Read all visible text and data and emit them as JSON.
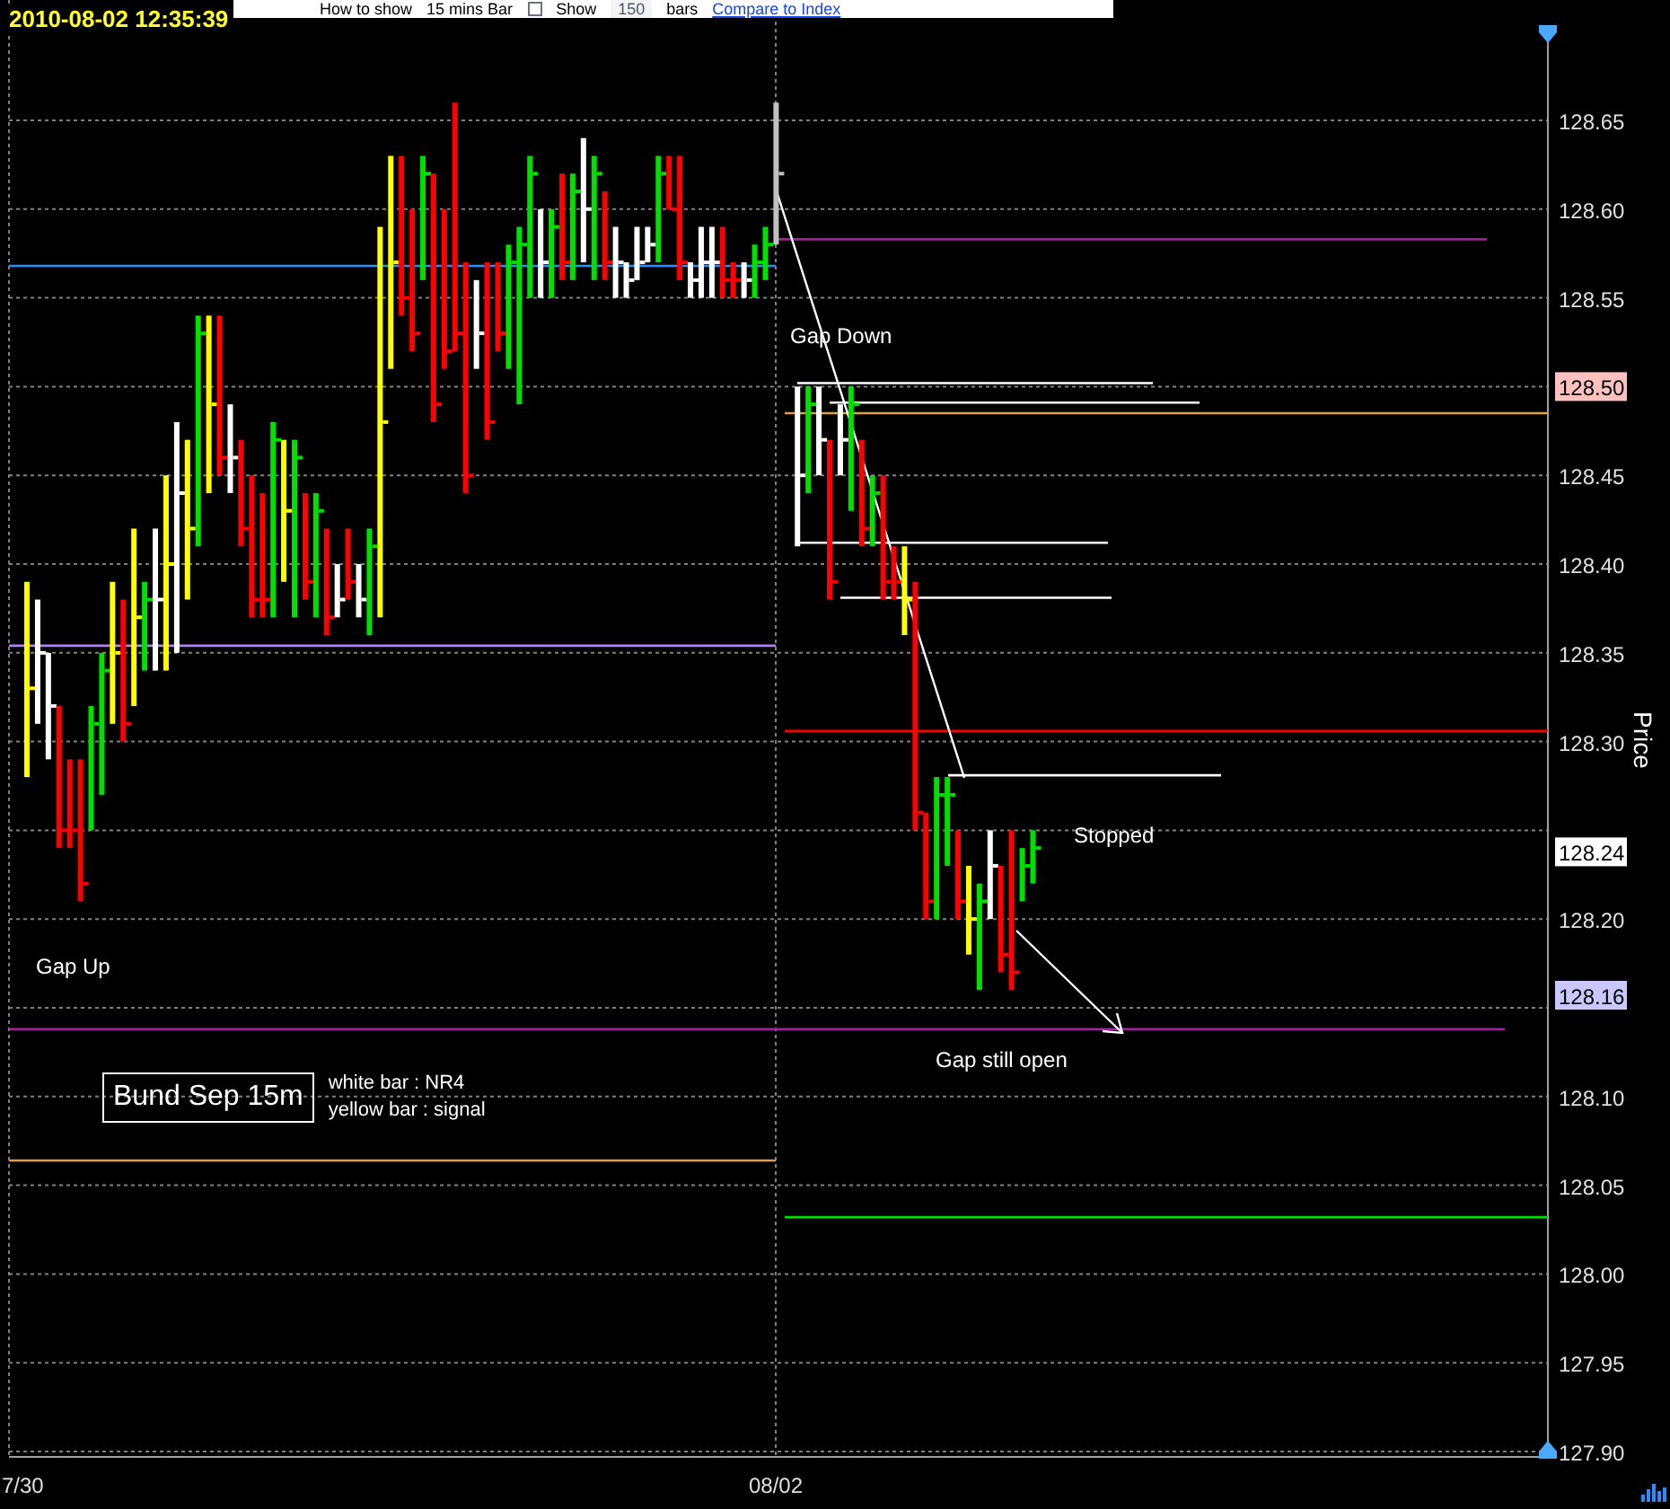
{
  "timestamp": "2010-08-02 12:35:39",
  "toolbar": {
    "how_to_show_label": "How to show",
    "interval": "15 mins Bar",
    "show": {
      "label": "Show",
      "checked": false
    },
    "bar_count": "150",
    "bars_label": "bars",
    "compare_link": "Compare to Index"
  },
  "legend": {
    "title": "Bund Sep 15m",
    "lines": [
      "white bar : NR4",
      "yellow bar : signal"
    ]
  },
  "price_axis": {
    "title": "Price",
    "labels": [
      {
        "kind": "tick",
        "text": "128.65"
      },
      {
        "kind": "tick",
        "text": "128.60"
      },
      {
        "kind": "tick",
        "text": "128.55"
      },
      {
        "kind": "marker",
        "text": "128.50",
        "color": "#ffc0c0"
      },
      {
        "kind": "tick",
        "text": "128.45"
      },
      {
        "kind": "tick",
        "text": "128.40"
      },
      {
        "kind": "tick",
        "text": "128.35"
      },
      {
        "kind": "tick",
        "text": "128.30"
      },
      {
        "kind": "marker",
        "text": "128.24",
        "color": "#ffffff"
      },
      {
        "kind": "tick",
        "text": "128.20"
      },
      {
        "kind": "marker",
        "text": "128.16",
        "color": "#c8c8ff"
      },
      {
        "kind": "tick",
        "text": "128.10"
      },
      {
        "kind": "tick",
        "text": "128.05"
      },
      {
        "kind": "tick",
        "text": "128.00"
      },
      {
        "kind": "tick",
        "text": "127.95"
      },
      {
        "kind": "tick",
        "text": "127.90"
      }
    ]
  },
  "date_axis": {
    "labels": [
      "7/30",
      "08/02"
    ]
  },
  "annotations": [
    "Gap Up",
    "Gap Down",
    "Stopped",
    "Gap still open"
  ]
}
